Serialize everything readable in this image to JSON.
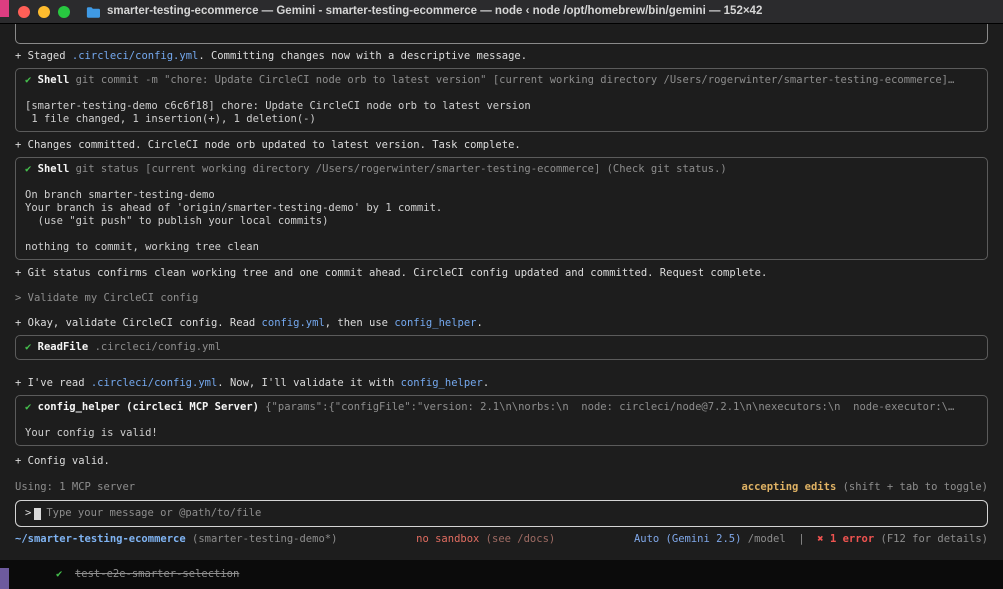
{
  "colors": {
    "terminal_bg": "#1d1d1d",
    "titlebar_bg": "#2b2b2d",
    "accent_link_blue": "#74a8ee",
    "success_green": "#45c04d",
    "warning_yellow": "#dfb264",
    "error_red": "#ef5350"
  },
  "titlebar": {
    "title": "smarter-testing-ecommerce — Gemini - smarter-testing-ecommerce — node ‹ node /opt/homebrew/bin/gemini — 152×42"
  },
  "conversation": {
    "msg_staged": {
      "segments": [
        [
          "+ Staged ",
          "fg"
        ],
        [
          ".circleci/config.yml",
          "link"
        ],
        [
          ". Committing changes now with a descriptive message.",
          "fg"
        ]
      ]
    },
    "tool_commit": {
      "header": [
        [
          "✔ ",
          "green"
        ],
        [
          "Shell ",
          "boldfg"
        ],
        [
          "git commit -m \"chore: Update CircleCI node orb to latest version\" [current working directory /Users/rogerwinter/smarter-testing-ecommerce]…",
          "dim"
        ]
      ],
      "output": [
        "[smarter-testing-demo c6c6f18] chore: Update CircleCI node orb to latest version",
        " 1 file changed, 1 insertion(+), 1 deletion(-)"
      ]
    },
    "msg_committed": {
      "segments": [
        [
          "+ Changes committed. CircleCI node orb updated to latest version. Task complete.",
          "fg"
        ]
      ]
    },
    "tool_status": {
      "header": [
        [
          "✔ ",
          "green"
        ],
        [
          "Shell ",
          "boldfg"
        ],
        [
          "git status [current working directory /Users/rogerwinter/smarter-testing-ecommerce] (Check git status.)",
          "dim"
        ]
      ],
      "output": [
        "On branch smarter-testing-demo",
        "Your branch is ahead of 'origin/smarter-testing-demo' by 1 commit.",
        "  (use \"git push\" to publish your local commits)",
        "",
        "nothing to commit, working tree clean"
      ]
    },
    "msg_status_done": {
      "segments": [
        [
          "+ Git status confirms clean working tree and one commit ahead. CircleCI config updated and committed. Request complete.",
          "fg"
        ]
      ]
    },
    "user_validate": {
      "segments": [
        [
          "> Validate my CircleCI config",
          "dim"
        ]
      ]
    },
    "msg_okay": {
      "segments": [
        [
          "+ Okay, validate CircleCI config. Read ",
          "fg"
        ],
        [
          "config.yml",
          "link"
        ],
        [
          ", then use ",
          "fg"
        ],
        [
          "config_helper",
          "link"
        ],
        [
          ".",
          "fg"
        ]
      ]
    },
    "tool_readfile": {
      "header": [
        [
          "✔ ",
          "green"
        ],
        [
          "ReadFile ",
          "boldfg"
        ],
        [
          ".circleci/config.yml",
          "dim"
        ]
      ]
    },
    "msg_read": {
      "segments": [
        [
          "+ I've read ",
          "fg"
        ],
        [
          ".circleci/config.yml",
          "link"
        ],
        [
          ". Now, I'll validate it with ",
          "fg"
        ],
        [
          "config_helper",
          "link"
        ],
        [
          ".",
          "fg"
        ]
      ]
    },
    "tool_confighelper": {
      "header": [
        [
          "✔ ",
          "green"
        ],
        [
          "config_helper (circleci MCP Server) ",
          "boldfg"
        ],
        [
          "{\"params\":{\"configFile\":\"version: 2.1\\n\\norbs:\\n  node: circleci/node@7.2.1\\n\\nexecutors:\\n  node-executor:\\…",
          "dim"
        ]
      ],
      "output": [
        "Your config is valid!"
      ]
    },
    "msg_valid": {
      "segments": [
        [
          "+ Config valid.",
          "fg"
        ]
      ]
    }
  },
  "status_bar": {
    "left": [
      [
        "Using: 1 MCP server",
        "dim"
      ]
    ],
    "right": [
      [
        "accepting edits",
        "yellow"
      ],
      [
        " (shift + tab to toggle)",
        "dim"
      ]
    ]
  },
  "input": {
    "prompt": ">",
    "placeholder": "Type your message or @path/to/file"
  },
  "footer": {
    "left": [
      [
        "~/smarter-testing-ecommerce",
        "cyanbold"
      ],
      [
        " (smarter-testing-demo*)",
        "dim"
      ]
    ],
    "center": [
      [
        "no sandbox",
        "red"
      ],
      [
        " (see /docs)",
        "reddim"
      ]
    ],
    "right": [
      [
        "Auto (Gemini 2.5)",
        "blue"
      ],
      [
        " /model",
        "dim"
      ],
      [
        "  |  ",
        "dim"
      ],
      [
        "✖ 1 error",
        "redbold"
      ],
      [
        " (F12 for details)",
        "dim"
      ]
    ]
  },
  "background": {
    "partial_row": [
      [
        "✔  ",
        "green"
      ],
      [
        "test-e2e-smarter-selection",
        "strike"
      ]
    ]
  }
}
